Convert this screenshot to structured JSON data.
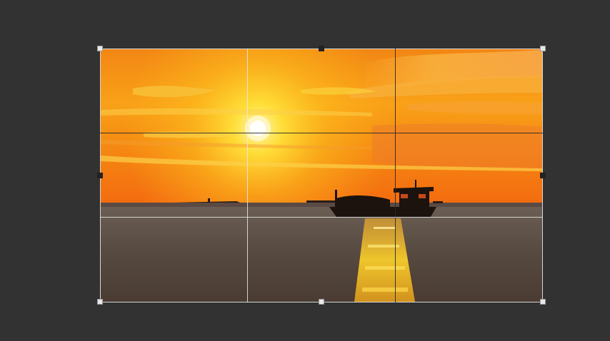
{
  "app": {
    "tool": "crop",
    "overlay": "rule-of-thirds"
  },
  "photo": {
    "subject": "boat-at-sunset",
    "colors": {
      "sky_top": "#f38a14",
      "sky_mid": "#fcb21a",
      "sun": "#fff7c8",
      "horizon": "#f36f10",
      "water": "#4f4741",
      "reflection": "#ffd22a",
      "silhouette": "#1c120e"
    }
  },
  "colors": {
    "workspace": "#323232",
    "frame": "#d6d6d6",
    "handle": "#e8e8e8"
  }
}
